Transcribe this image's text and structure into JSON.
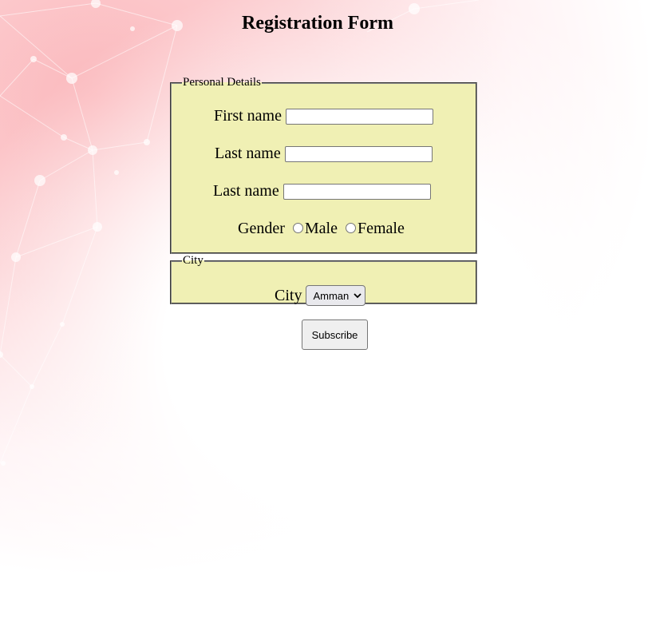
{
  "page": {
    "title": "Registration Form"
  },
  "personal_details": {
    "legend": "Personal Details",
    "first_name": {
      "label": "First name",
      "value": ""
    },
    "last_name": {
      "label": "Last name",
      "value": ""
    },
    "last_name_2": {
      "label": "Last name",
      "value": ""
    },
    "gender": {
      "label": "Gender",
      "options": [
        "Male",
        "Female"
      ],
      "selected": null
    }
  },
  "city_section": {
    "legend": "City",
    "label": "City",
    "selected": "Amman",
    "dropdown_icon": "chevron-down-icon"
  },
  "actions": {
    "subscribe_label": "Subscribe"
  },
  "colors": {
    "fieldset_background": "#f0f0b4",
    "button_background": "#efefef",
    "background_tint": "#fbb9bd"
  }
}
